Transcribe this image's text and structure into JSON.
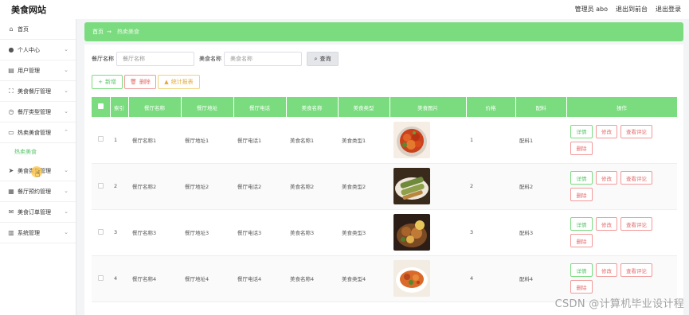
{
  "app": {
    "title": "美食网站"
  },
  "topnav": {
    "user": "管理员 abo",
    "front": "退出到前台",
    "logout": "退出登录"
  },
  "sidebar": {
    "items": [
      {
        "label": "首页",
        "icon": "home-icon",
        "has_children": false
      },
      {
        "label": "个人中心",
        "icon": "user-icon",
        "has_children": true
      },
      {
        "label": "用户管理",
        "icon": "document-icon",
        "has_children": true
      },
      {
        "label": "美食餐厅管理",
        "icon": "expand-icon",
        "has_children": true
      },
      {
        "label": "餐厅类型管理",
        "icon": "clock-icon",
        "has_children": true
      },
      {
        "label": "热卖美食管理",
        "icon": "chat-icon",
        "has_children": true,
        "expanded": true
      },
      {
        "label": "美食类型管理",
        "icon": "send-icon",
        "has_children": true
      },
      {
        "label": "餐厅预约管理",
        "icon": "grid-icon",
        "has_children": true
      },
      {
        "label": "美食订单管理",
        "icon": "mail-icon",
        "has_children": true
      },
      {
        "label": "系统管理",
        "icon": "chart-icon",
        "has_children": true
      }
    ],
    "active_sub": "热卖美食"
  },
  "breadcrumb": {
    "home": "首页",
    "current": "热卖美食"
  },
  "search": {
    "restaurant_label": "餐厅名称",
    "restaurant_placeholder": "餐厅名称",
    "food_label": "美食名称",
    "food_placeholder": "美食名称",
    "button": "查询"
  },
  "actions": {
    "add": "新增",
    "delete": "删除",
    "stats": "统计报表"
  },
  "table": {
    "columns": [
      "索引",
      "餐厅名称",
      "餐厅地址",
      "餐厅电话",
      "美食名称",
      "美食类型",
      "美食图片",
      "价格",
      "配料",
      "操作"
    ],
    "rows": [
      {
        "index": "1",
        "name": "餐厅名称1",
        "address": "餐厅地址1",
        "phone": "餐厅电话1",
        "food": "美食名称1",
        "type": "美食类型1",
        "price": "1",
        "ingredients": "配料1"
      },
      {
        "index": "2",
        "name": "餐厅名称2",
        "address": "餐厅地址2",
        "phone": "餐厅电话2",
        "food": "美食名称2",
        "type": "美食类型2",
        "price": "2",
        "ingredients": "配料2"
      },
      {
        "index": "3",
        "name": "餐厅名称3",
        "address": "餐厅地址3",
        "phone": "餐厅电话3",
        "food": "美食名称3",
        "type": "美食类型3",
        "price": "3",
        "ingredients": "配料3"
      },
      {
        "index": "4",
        "name": "餐厅名称4",
        "address": "餐厅地址4",
        "phone": "餐厅电话4",
        "food": "美食名称4",
        "type": "美食类型4",
        "price": "4",
        "ingredients": "配料4"
      }
    ],
    "ops": {
      "detail": "详情",
      "edit": "修改",
      "review": "查看评论",
      "delete": "删除"
    }
  },
  "watermark": "CSDN @计算机毕业设计程",
  "colors": {
    "accent": "#7bdc7f",
    "danger": "#e36b6b",
    "warning": "#e2a93b"
  }
}
